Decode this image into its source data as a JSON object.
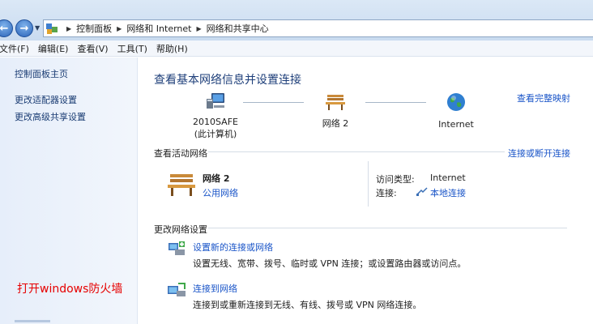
{
  "breadcrumb": [
    "控制面板",
    "网络和 Internet",
    "网络和共享中心"
  ],
  "menu": [
    "文件(F)",
    "编辑(E)",
    "查看(V)",
    "工具(T)",
    "帮助(H)"
  ],
  "sidebar": {
    "home": "控制面板主页",
    "links": [
      "更改适配器设置",
      "更改高级共享设置"
    ],
    "annotation": "打开windows防火墙"
  },
  "main": {
    "title": "查看基本网络信息并设置连接",
    "full_map": "查看完整映射",
    "map": {
      "computer": {
        "name": "2010SAFE",
        "sub": "(此计算机)"
      },
      "network": {
        "name": "网络 2"
      },
      "internet": {
        "name": "Internet"
      }
    },
    "active": {
      "heading": "查看活动网络",
      "connect_link": "连接或断开连接",
      "name": "网络 2",
      "type": "公用网络",
      "access_label": "访问类型:",
      "access_value": "Internet",
      "conn_label": "连接:",
      "conn_value": "本地连接"
    },
    "change": {
      "heading": "更改网络设置",
      "tasks": [
        {
          "title": "设置新的连接或网络",
          "desc": "设置无线、宽带、拨号、临时或 VPN 连接；或设置路由器或访问点。"
        },
        {
          "title": "连接到网络",
          "desc": "连接到或重新连接到无线、有线、拨号或 VPN 网络连接。"
        }
      ]
    }
  },
  "colors": {
    "link": "#1a55c8",
    "title": "#1e3f7a",
    "annotation": "#e60000"
  }
}
